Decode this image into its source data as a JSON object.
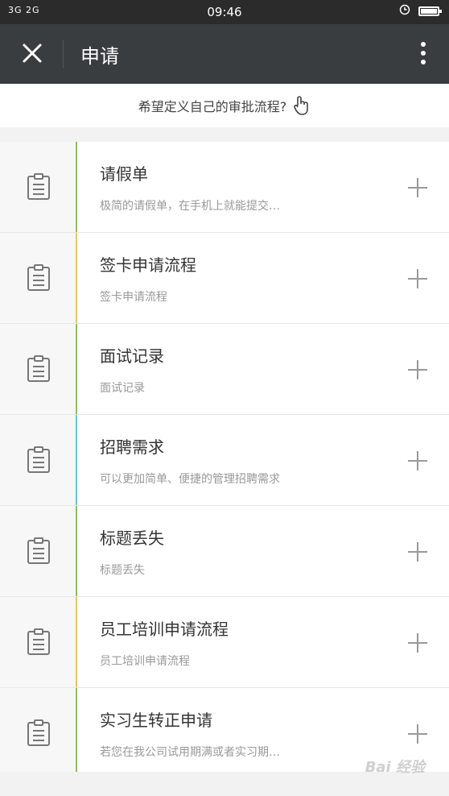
{
  "status_bar": {
    "network": "3G 2G",
    "time": "09:46"
  },
  "header": {
    "title": "申请"
  },
  "hint": {
    "text": "希望定义自己的审批流程?"
  },
  "items": [
    {
      "title": "请假单",
      "desc": "极简的请假单，在手机上就能提交…",
      "accent": "#8bc34a"
    },
    {
      "title": "签卡申请流程",
      "desc": "签卡申请流程",
      "accent": "#f4c542"
    },
    {
      "title": "面试记录",
      "desc": "面试记录",
      "accent": "#8bc34a"
    },
    {
      "title": "招聘需求",
      "desc": "可以更加简单、便捷的管理招聘需求",
      "accent": "#4dd0e1"
    },
    {
      "title": "标题丢失",
      "desc": "标题丢失",
      "accent": "#8bc34a"
    },
    {
      "title": "员工培训申请流程",
      "desc": "员工培训申请流程",
      "accent": "#f4c542"
    },
    {
      "title": "实习生转正申请",
      "desc": "若您在我公司试用期满或者实习期…",
      "accent": "#8bc34a"
    }
  ],
  "watermark": "Bai 经验"
}
